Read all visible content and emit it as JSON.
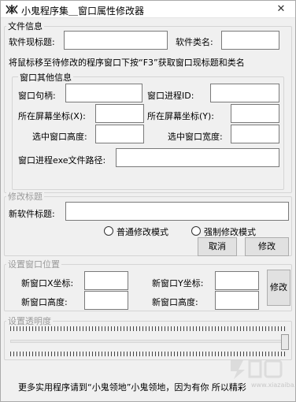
{
  "window": {
    "title": "小鬼程序集＿窗口属性修改器",
    "close_glyph": "✕"
  },
  "file_info": {
    "group_title": "文件信息",
    "current_title_label": "软件现标题:",
    "current_title_value": "",
    "class_label": "软件类名:",
    "class_value": "",
    "hint": "将鼠标移至待修改的程序窗口下按“F3”获取窗口现标题和类名",
    "other": {
      "group_title": "窗口其他信息",
      "handle_label": "窗口句柄:",
      "handle_value": "",
      "pid_label": "窗口进程ID:",
      "pid_value": "",
      "x_label": "所在屏幕坐标(X):",
      "x_value": "",
      "y_label": "所在屏幕坐标(Y):",
      "y_value": "",
      "height_label": "选中窗口高度:",
      "height_value": "",
      "width_label": "选中窗口宽度:",
      "width_value": "",
      "path_label": "窗口进程exe文件路径:",
      "path_value": ""
    }
  },
  "modify_title": {
    "group_title": "修改标题",
    "new_title_label": "新软件标题:",
    "new_title_value": "",
    "mode_normal": "普通修改模式",
    "mode_force": "强制修改模式",
    "cancel_label": "取消",
    "modify_label": "修改"
  },
  "position": {
    "group_title": "设置窗口位置",
    "new_x_label": "新窗口X坐标:",
    "new_x_value": "",
    "new_y_label": "新窗口Y坐标:",
    "new_y_value": "",
    "new_h1_label": "新窗口高度:",
    "new_h1_value": "",
    "new_h2_label": "新窗口高度:",
    "new_h2_value": "",
    "modify_label": "修改"
  },
  "opacity": {
    "group_title": "设置透明度",
    "level": 1.0
  },
  "footer": {
    "text": "更多实用程序请到“小鬼领地”小鬼领地，因为有你 所以精彩"
  },
  "watermark": {
    "text": "www.xiazaiba.com"
  }
}
